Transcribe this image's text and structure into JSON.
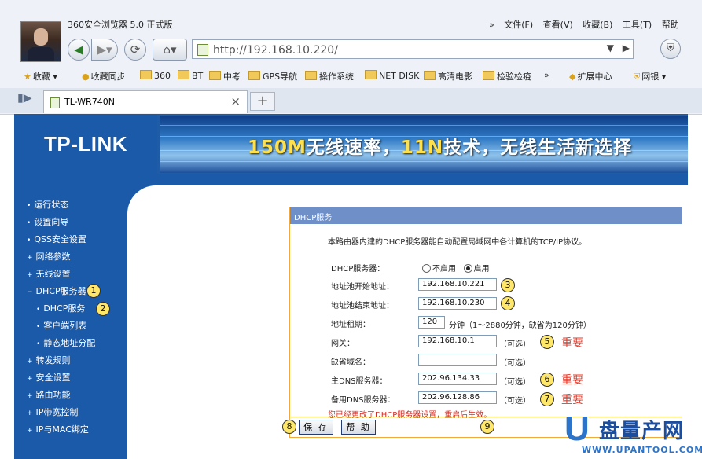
{
  "browser": {
    "title": "360安全浏览器 5.0 正式版",
    "menu": [
      "文件(F)",
      "查看(V)",
      "收藏(B)",
      "工具(T)",
      "帮助"
    ],
    "menu_chevron": "»",
    "url": "http://192.168.10.220/",
    "bookmarks": [
      "收藏",
      "收藏同步",
      "360",
      "BT",
      "中考",
      "GPS导航",
      "操作系统",
      "NET DISK",
      "高清电影",
      "检验检疫",
      "扩展中心",
      "网银"
    ],
    "bookmarks_chevron": "»",
    "tab_label": "TL-WR740N"
  },
  "banner": {
    "logo": "TP-LINK",
    "slogan_part1": "150M",
    "slogan_part2": "无线速率，",
    "slogan_part3": "11N",
    "slogan_part4": "技术，无线生活新选择"
  },
  "sidebar": {
    "items": [
      {
        "bullet": "•",
        "label": "运行状态"
      },
      {
        "bullet": "•",
        "label": "设置向导"
      },
      {
        "bullet": "•",
        "label": "QSS安全设置"
      },
      {
        "bullet": "+",
        "label": "网络参数"
      },
      {
        "bullet": "+",
        "label": "无线设置"
      },
      {
        "bullet": "−",
        "label": "DHCP服务器"
      },
      {
        "bullet": "•",
        "label": "DHCP服务"
      },
      {
        "bullet": "•",
        "label": "客户端列表"
      },
      {
        "bullet": "•",
        "label": "静态地址分配"
      },
      {
        "bullet": "+",
        "label": "转发规则"
      },
      {
        "bullet": "+",
        "label": "安全设置"
      },
      {
        "bullet": "+",
        "label": "路由功能"
      },
      {
        "bullet": "+",
        "label": "IP带宽控制"
      },
      {
        "bullet": "+",
        "label": "IP与MAC绑定"
      }
    ]
  },
  "dhcp": {
    "panel_title": "DHCP服务",
    "intro": "本路由器内建的DHCP服务器能自动配置局域网中各计算机的TCP/IP协议。",
    "server_label": "DHCP服务器：",
    "opt_disable": "不启用",
    "opt_enable": "启用",
    "start_label": "地址池开始地址：",
    "start_value": "192.168.10.221",
    "end_label": "地址池结束地址：",
    "end_value": "192.168.10.230",
    "lease_label": "地址租期：",
    "lease_value": "120",
    "lease_note": "分钟（1～2880分钟，缺省为120分钟）",
    "gateway_label": "网关：",
    "gateway_value": "192.168.10.1",
    "domain_label": "缺省域名：",
    "domain_value": "",
    "dns1_label": "主DNS服务器：",
    "dns1_value": "202.96.134.33",
    "dns2_label": "备用DNS服务器：",
    "dns2_value": "202.96.128.86",
    "optional": "（可选）",
    "warning": "您已经更改了DHCP服务器设置，重启后生效。",
    "save": "保 存",
    "help": "帮 助"
  },
  "annotations": {
    "important": "重要",
    "numbers": [
      "1",
      "2",
      "3",
      "4",
      "5",
      "6",
      "7",
      "8",
      "9"
    ]
  },
  "watermark": {
    "u": "U",
    "name": "盘量产网",
    "site": "WWW.UPANTOOL.COM"
  }
}
